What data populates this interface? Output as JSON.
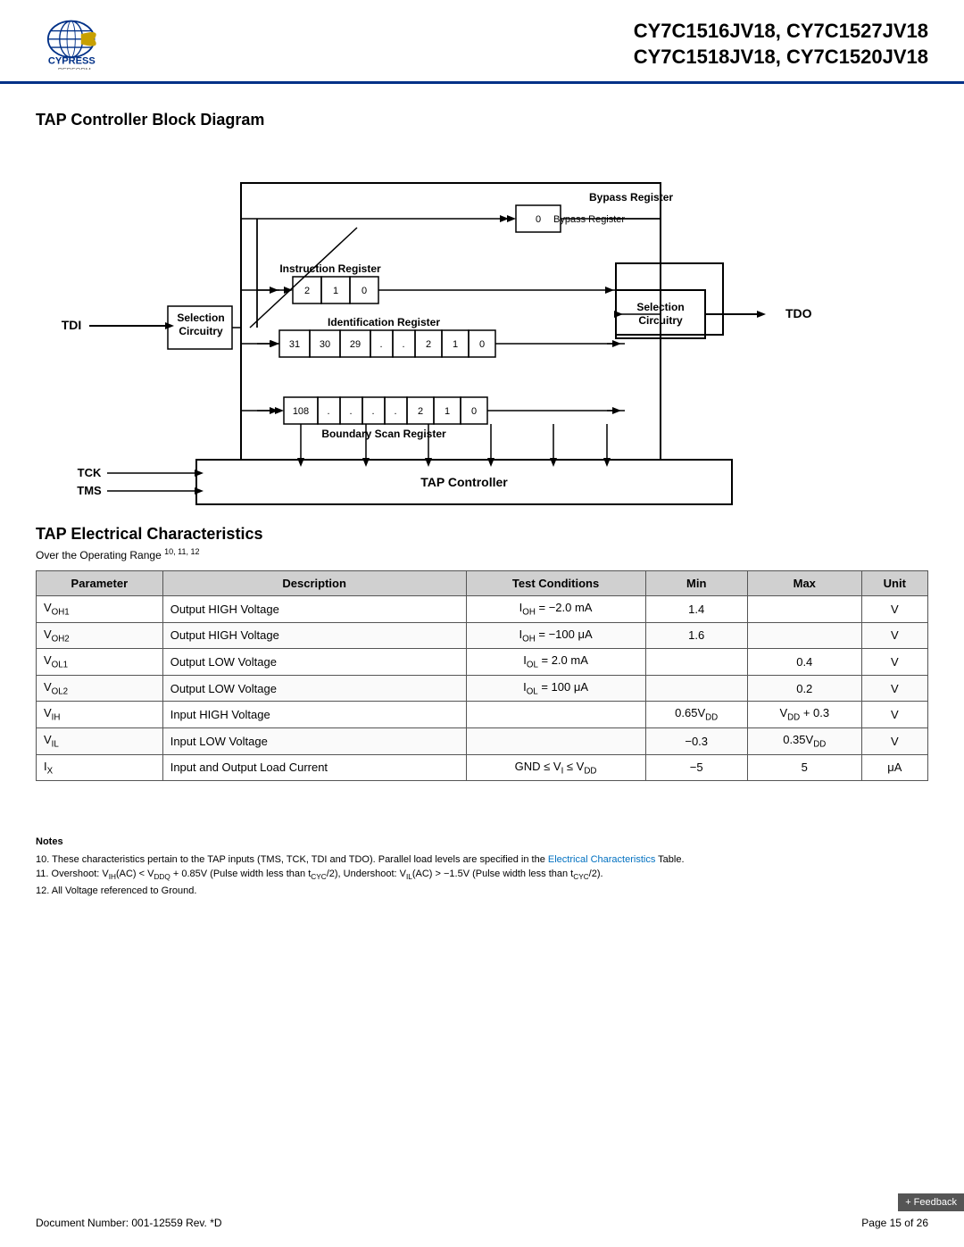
{
  "header": {
    "title_line1": "CY7C1516JV18, CY7C1527JV18",
    "title_line2": "CY7C1518JV18, CY7C1520JV18"
  },
  "diagram_section": {
    "title": "TAP Controller Block Diagram"
  },
  "tap_diagram": {
    "tdi_label": "TDI",
    "tdo_label": "TDO",
    "tck_label": "TCK",
    "tms_label": "TMS",
    "selection_circuitry_left": "Selection Circuitry",
    "selection_circuitry_right": "Selection Circuitry",
    "bypass_register": "Bypass Register",
    "instruction_register": "Instruction Register",
    "identification_register": "Identification Register",
    "boundary_scan_register": "Boundary Scan Register",
    "tap_controller": "TAP Controller",
    "bypass_cells": [
      "0"
    ],
    "instruction_cells": [
      "2",
      "1",
      "0"
    ],
    "id_cells": [
      "31",
      "30",
      "29",
      ".",
      ".",
      "2",
      "1",
      "0"
    ],
    "boundary_cells": [
      "108",
      ".",
      ".",
      ".",
      ".",
      "2",
      "1",
      "0"
    ]
  },
  "elec_section": {
    "title": "TAP Electrical Characteristics",
    "subtitle": "Over the Operating Range",
    "subtitle_refs": "10, 11, 12",
    "table": {
      "headers": [
        "Parameter",
        "Description",
        "Test Conditions",
        "Min",
        "Max",
        "Unit"
      ],
      "rows": [
        {
          "param": "V_OH1",
          "param_display": "V₀H1",
          "description": "Output HIGH Voltage",
          "test_conditions": "I₀H = −2.0 mA",
          "min": "1.4",
          "max": "",
          "unit": "V"
        },
        {
          "param": "V_OH2",
          "param_display": "V₀H2",
          "description": "Output HIGH Voltage",
          "test_conditions": "I₀H = −100 μA",
          "min": "1.6",
          "max": "",
          "unit": "V"
        },
        {
          "param": "V_OL1",
          "param_display": "V₀L1",
          "description": "Output LOW Voltage",
          "test_conditions": "I₀L = 2.0 mA",
          "min": "",
          "max": "0.4",
          "unit": "V"
        },
        {
          "param": "V_OL2",
          "param_display": "V₀L2",
          "description": "Output LOW Voltage",
          "test_conditions": "I₀L = 100 μA",
          "min": "",
          "max": "0.2",
          "unit": "V"
        },
        {
          "param": "V_IH",
          "param_display": "VᴵH",
          "description": "Input HIGH Voltage",
          "test_conditions": "",
          "min": "0.65V_DD",
          "max": "V_DD + 0.3",
          "unit": "V"
        },
        {
          "param": "V_IL",
          "param_display": "VᴵL",
          "description": "Input LOW Voltage",
          "test_conditions": "",
          "min": "−0.3",
          "max": "0.35V_DD",
          "unit": "V"
        },
        {
          "param": "I_X",
          "param_display": "I_X",
          "description": "Input and Output Load Current",
          "test_conditions": "GND ≤ Vᴵ ≤ V_DD",
          "min": "−5",
          "max": "5",
          "unit": "μA"
        }
      ]
    }
  },
  "notes": {
    "title": "Notes",
    "items": [
      "10. These characteristics pertain to the TAP inputs (TMS, TCK, TDI and TDO). Parallel load levels are specified in the Electrical Characteristics Table.",
      "11. Overshoot: VᴵH(AC) < V_DDQ + 0.85V (Pulse width less than t_CYC/2), Undershoot: VᴵL(AC) > −1.5V (Pulse width less than t_CYC/2).",
      "12. All Voltage referenced to Ground."
    ]
  },
  "footer": {
    "doc_number": "Document Number: 001-12559 Rev. *D",
    "page": "Page 15 of 26"
  },
  "feedback": {
    "label": "+ Feedback"
  }
}
